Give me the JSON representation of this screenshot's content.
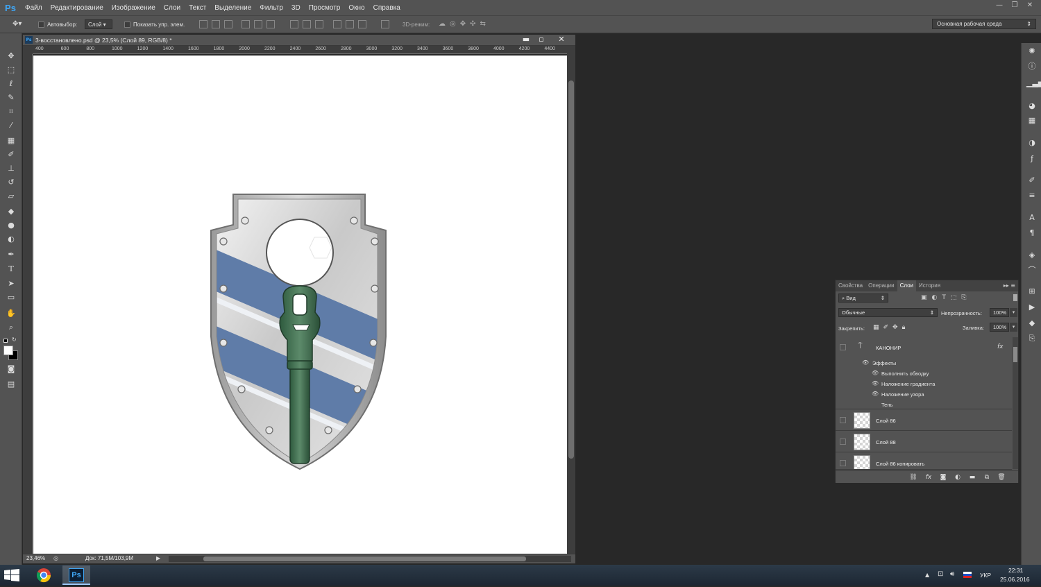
{
  "app": {
    "logo": "Ps"
  },
  "menu": [
    "Файл",
    "Редактирование",
    "Изображение",
    "Слои",
    "Текст",
    "Выделение",
    "Фильтр",
    "3D",
    "Просмотр",
    "Окно",
    "Справка"
  ],
  "options_bar": {
    "autoselect_label": "Автовыбор:",
    "autoselect_value": "Слой",
    "show_transform_label": "Показать упр. элем.",
    "mode_3d_label": "3D-режим:",
    "workspace": "Основная рабочая среда"
  },
  "document": {
    "title": "3-восстановлено.psd @ 23,5% (Слой 89, RGB/8) *",
    "ruler_top": [
      "400",
      "600",
      "800",
      "1000",
      "1200",
      "1400",
      "1600",
      "1800",
      "2000",
      "2200",
      "2400",
      "2600",
      "2800",
      "3000",
      "3200",
      "3400",
      "3600",
      "3800",
      "4000",
      "4200",
      "4400"
    ],
    "zoom": "23,46%",
    "doc_size": "Док: 71,5M/103,9M"
  },
  "layers_panel": {
    "tabs": [
      "Свойства",
      "Операции",
      "Слои",
      "История"
    ],
    "active_tab": "Слои",
    "filter_kind": "Вид",
    "blend_mode": "Обычные",
    "opacity_label": "Непрозрачность:",
    "opacity_value": "100%",
    "lock_label": "Закрепить:",
    "fill_label": "Заливка:",
    "fill_value": "100%",
    "layers": [
      {
        "name": "КАНОНИР",
        "type": "text",
        "fx": "fx",
        "effects_label": "Эффекты",
        "effects": [
          "Выполнить обводку",
          "Наложение градиента",
          "Наложение узора",
          "Тень"
        ]
      },
      {
        "name": "Слой 86"
      },
      {
        "name": "Слой 88"
      },
      {
        "name": "Слой 86 копировать"
      }
    ]
  },
  "taskbar": {
    "lang": "УКР",
    "time": "22:31",
    "date": "25.06.2016",
    "ps_label": "Ps"
  },
  "colors": {
    "ui_bg": "#535353",
    "workspace_bg": "#282828",
    "shield_blue": "#5f7ca8",
    "cannon_green": "#3f6a4f"
  },
  "icons": {
    "right_strip": [
      "color-icon",
      "info-icon",
      "histogram-icon",
      "swatches-icon",
      "grid-icon",
      "adjustments-icon",
      "styles-icon",
      "brush-icon",
      "brush-presets-icon",
      "character-icon",
      "paragraph-icon",
      "3d-icon",
      "paths-icon",
      "channels-icon",
      "actions-icon",
      "layers-icon",
      "layer-comps-icon"
    ]
  }
}
